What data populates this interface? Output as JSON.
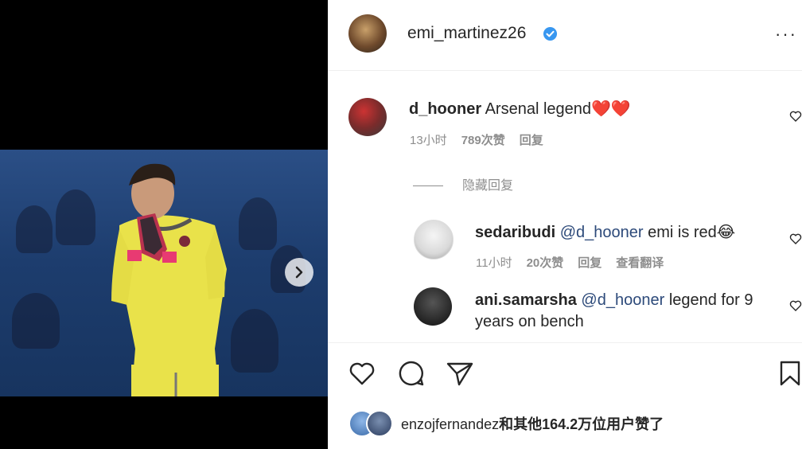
{
  "post": {
    "author": "emi_martinez26",
    "verified": true,
    "more_label": "···"
  },
  "comments": [
    {
      "user": "d_hooner",
      "text": "Arsenal legend",
      "emoji": "❤️❤️",
      "time": "13小时",
      "likes": "789次赞",
      "reply": "回复"
    }
  ],
  "hide_replies": "隐藏回复",
  "replies": [
    {
      "user": "sedaribudi",
      "mention": "@d_hooner",
      "text": "emi is red",
      "emoji": "😂",
      "time": "11小时",
      "likes": "20次赞",
      "reply": "回复",
      "translate": "查看翻译"
    },
    {
      "user": "ani.samarsha",
      "mention": "@d_hooner",
      "text": "legend for 9 years on bench"
    }
  ],
  "liked_by": {
    "user": "enzojfernandez",
    "rest": "和其他164.2万位用户赞了"
  },
  "icons": {
    "like": "heart-icon",
    "comment": "comment-icon",
    "share": "send-icon",
    "save": "bookmark-icon",
    "next": "chevron-right-icon"
  },
  "colors": {
    "verified": "#3897f0",
    "heart": "#e0243a",
    "mention": "#2d4a7a",
    "meta": "#8e8e8e"
  }
}
